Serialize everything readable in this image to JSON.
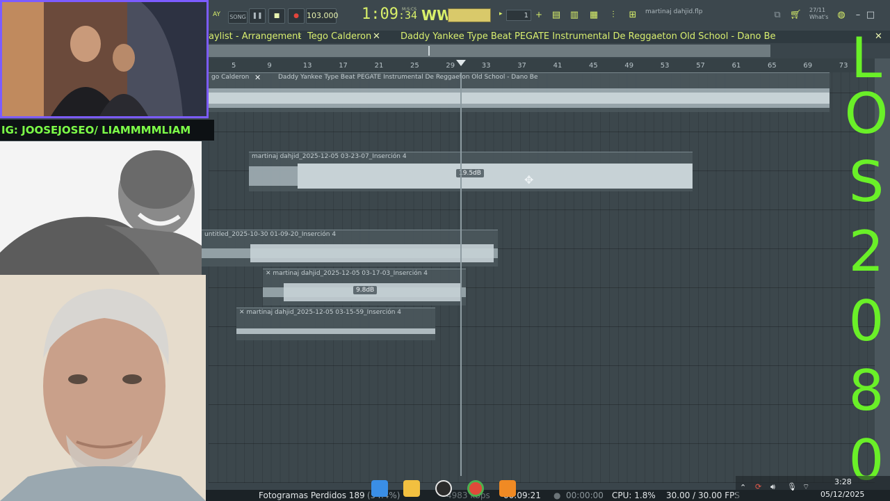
{
  "toolbar": {
    "song_label": "SONG",
    "tempo": "103.000",
    "time": "1:09",
    "time_small": "34",
    "time_unit": "M:S:CS",
    "pattern_num": "1",
    "project_name": "martinaj dahjid.flp",
    "news_date": "27/11",
    "news_label": "What's"
  },
  "playlist": {
    "title_left": "aylist - Arrangement",
    "title_sep": "›",
    "title_mid": "Tego Calderon",
    "title_right": "Daddy Yankee Type Beat PEGATE Instrumental De Reggaeton Old School - Dano Be",
    "ruler": [
      "5",
      "9",
      "13",
      "17",
      "21",
      "25",
      "29",
      "33",
      "37",
      "41",
      "45",
      "49",
      "53",
      "57",
      "61",
      "65",
      "69",
      "73"
    ]
  },
  "clips": [
    {
      "label_a": "go Calderon",
      "label_b": "Daddy Yankee Type Beat PEGATE Instrumental De Reggaeton Old School - Dano Be"
    },
    {
      "label": "martinaj dahjid_2025-12-05 03-23-07_Inserción 4",
      "db": "19.5dB"
    },
    {
      "label": "untitled_2025-10-30 01-09-20_Inserción 4"
    },
    {
      "label": "martinaj dahjid_2025-12-05 03-17-03_Inserción 4",
      "db": "9.8dB"
    },
    {
      "label": "martinaj dahjid_2025-12-05 03-15-59_Inserción 4"
    }
  ],
  "overlay": {
    "letters": [
      "L",
      "O",
      "S",
      "2",
      "0",
      "8",
      "0"
    ],
    "ig_banner": "IG: JOOSEJOSEO/ LIAMMMMLIAM",
    "color": "#6af028"
  },
  "status": {
    "frames": "Fotogramas Perdidos 189",
    "frames_pct": "(54.4%)",
    "kbps": "4983 kbps",
    "rec_time": "00:09:21",
    "stream_time": "00:00:00",
    "cpu": "CPU: 1.8%",
    "fps": "30.00 / 30.00 FPS"
  },
  "tray": {
    "time": "3:28",
    "date": "05/12/2025"
  },
  "icons": [
    "windows-start-icon",
    "file-explorer-icon",
    "obs-icon",
    "chrome-icon",
    "fl-studio-icon",
    "wifi-icon",
    "volume-icon",
    "mic-icon"
  ]
}
